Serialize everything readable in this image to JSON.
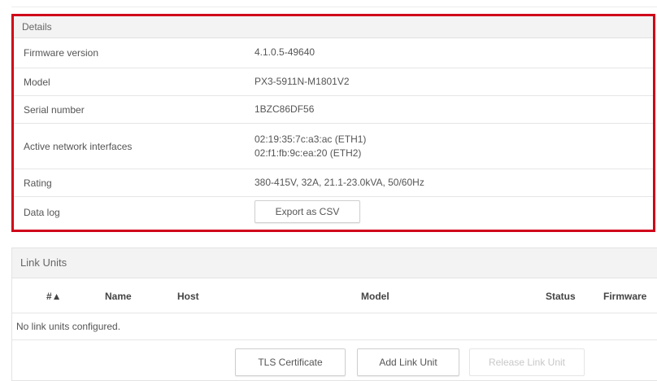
{
  "details": {
    "title": "Details",
    "rows": [
      {
        "label": "Firmware version",
        "value": "4.1.0.5-49640"
      },
      {
        "label": "Model",
        "value": "PX3-5911N-M1801V2"
      },
      {
        "label": "Serial number",
        "value": "1BZC86DF56"
      },
      {
        "label": "Active network interfaces",
        "value_lines": [
          "02:19:35:7c:a3:ac (ETH1)",
          "02:f1:fb:9c:ea:20 (ETH2)"
        ]
      },
      {
        "label": "Rating",
        "value": "380-415V, 32A, 21.1-23.0kVA, 50/60Hz"
      },
      {
        "label": "Data log",
        "button": "Export as CSV"
      }
    ],
    "highlight_color": "#d0021b"
  },
  "link_units": {
    "title": "Link Units",
    "columns": [
      "#▲",
      "Name",
      "Host",
      "Model",
      "Status",
      "Firmware"
    ],
    "empty_message": "No link units configured.",
    "buttons": {
      "tls": "TLS Certificate",
      "add": "Add Link Unit",
      "release": "Release Link Unit"
    }
  }
}
